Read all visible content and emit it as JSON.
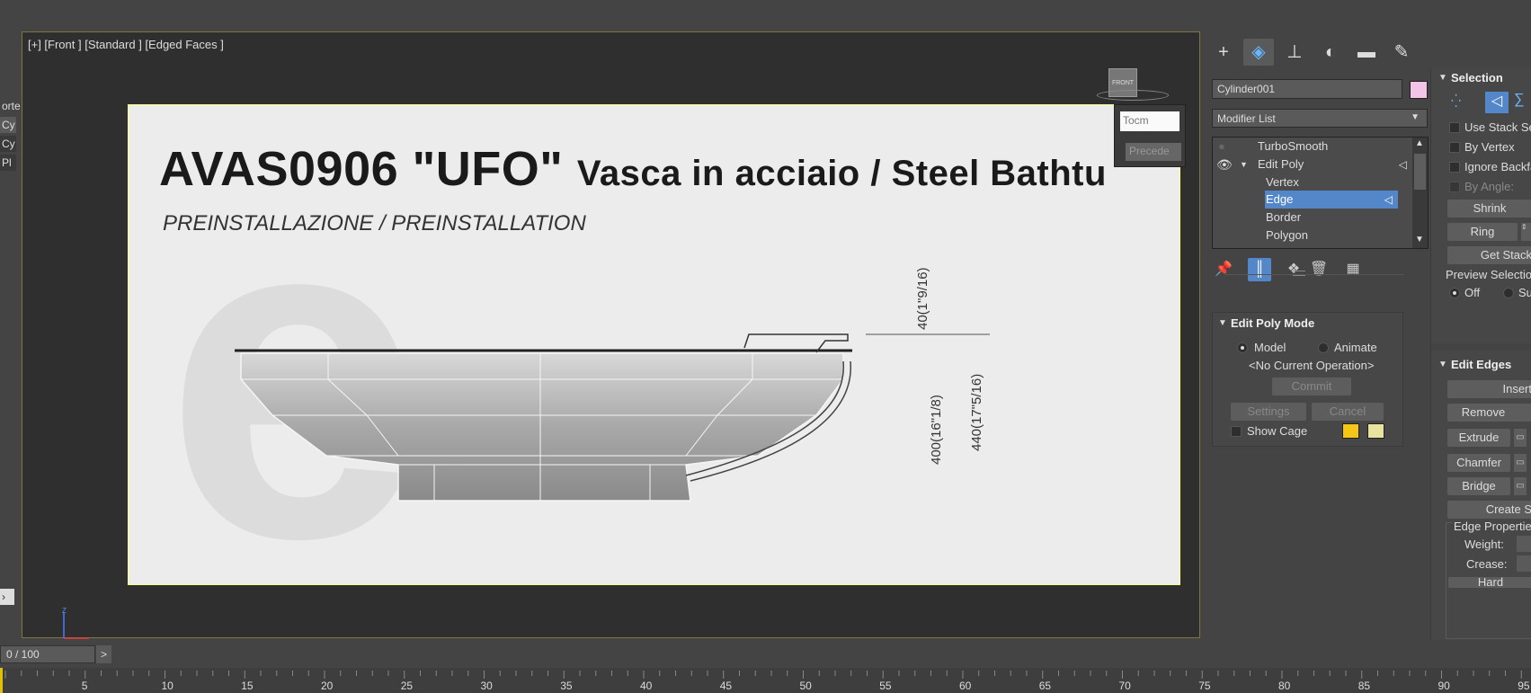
{
  "viewport": {
    "label": "[+] [Front ] [Standard ] [Edged Faces ]",
    "viewcube_label": "FRONT",
    "overlay_input": "Tocm",
    "overlay_button": "Precede"
  },
  "drawing": {
    "title_code": "AVAS0906 \"UFO\"",
    "title_rest": "Vasca in acciaio / Steel Bathtu",
    "subtitle": "PREINSTALLAZIONE / PREINSTALLATION",
    "dim1": "40(1\"9/16)",
    "dim2": "400(16\"1/8)",
    "dim3": "440(17\"5/16)"
  },
  "left_strip": [
    "orte",
    "Cy",
    "Cy",
    "Pl"
  ],
  "panel": {
    "tabs": [
      "create-icon",
      "modify-icon",
      "hierarchy-icon",
      "motion-icon",
      "display-icon",
      "utilities-icon"
    ],
    "object_name": "Cylinder001",
    "object_color": "#f3c3e8",
    "modifier_list": "Modifier List",
    "stack": [
      {
        "label": "TurboSmooth",
        "level": 0
      },
      {
        "label": "Edit Poly",
        "level": 0
      },
      {
        "label": "Vertex",
        "level": 1
      },
      {
        "label": "Edge",
        "level": 1
      },
      {
        "label": "Border",
        "level": 1
      },
      {
        "label": "Polygon",
        "level": 1
      }
    ],
    "selected_stack_item": "Edge",
    "edit_poly_mode": {
      "title": "Edit Poly Mode",
      "model": "Model",
      "animate": "Animate",
      "operation": "<No Current Operation>",
      "commit": "Commit",
      "settings": "Settings",
      "cancel": "Cancel",
      "show_cage": "Show Cage",
      "cage_color_1": "#f5c518",
      "cage_color_2": "#e9e3a0"
    },
    "selection": {
      "title": "Selection",
      "use_stack": "Use Stack Se",
      "by_vertex": "By Vertex",
      "ignore_backfacing": "Ignore Backfa",
      "by_angle": "By Angle:",
      "shrink": "Shrink",
      "ring": "Ring",
      "get_stack": "Get Stack",
      "preview_selection": "Preview Selection",
      "off": "Off",
      "sub": "Su"
    },
    "edit_edges": {
      "title": "Edit Edges",
      "insert": "Insert",
      "remove": "Remove",
      "extrude": "Extrude",
      "chamfer": "Chamfer",
      "bridge": "Bridge",
      "create": "Create S",
      "edge_properties": "Edge Properties",
      "weight": "Weight:",
      "crease": "Crease:",
      "hard": "Hard"
    }
  },
  "timeline": {
    "frame": "0 / 100",
    "next": ">",
    "ticks": [
      "5",
      "10",
      "15",
      "20",
      "25",
      "30",
      "35",
      "40",
      "45",
      "50",
      "55",
      "60",
      "65",
      "70",
      "75",
      "80",
      "85",
      "90",
      "95"
    ]
  }
}
